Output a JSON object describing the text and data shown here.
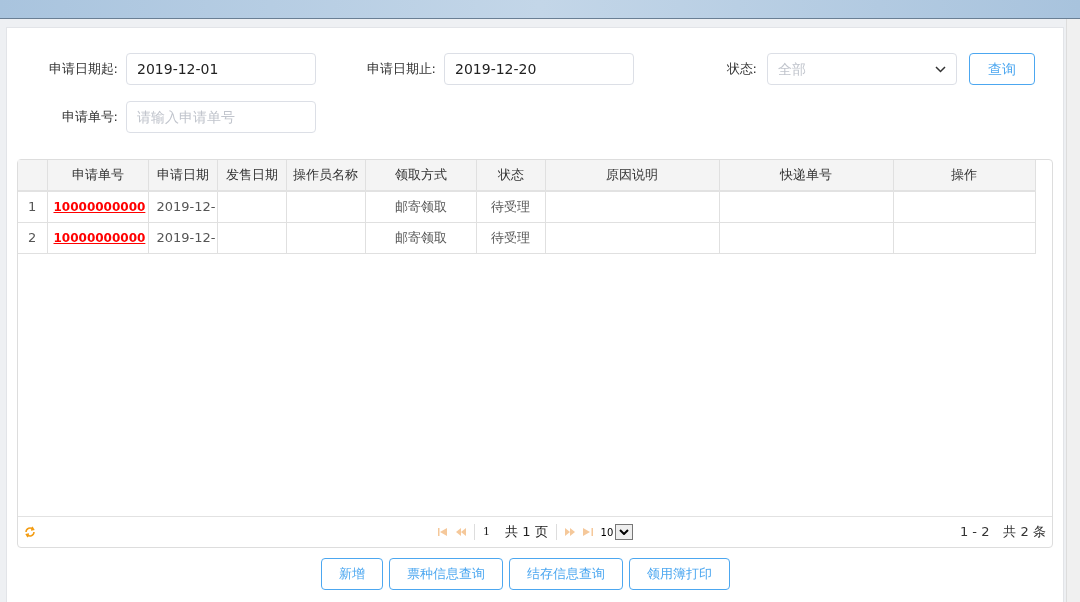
{
  "filters": [
    {
      "label": "申请日期起:",
      "value": "2019-12-01"
    },
    {
      "label": "申请日期止:",
      "value": "2019-12-20"
    },
    {
      "label": "申请单号:",
      "placeholder": "请输入申请单号"
    }
  ],
  "status_filter": {
    "label": "状态:",
    "placeholder": "全部"
  },
  "query_button": "查询",
  "table": {
    "columns": [
      "申请单号",
      "申请日期",
      "发售日期",
      "操作员名称",
      "领取方式",
      "状态",
      "原因说明",
      "快递单号",
      "操作"
    ],
    "rows": [
      {
        "index": "1",
        "cells": [
          "10000000000",
          "2019-12-",
          "",
          "",
          "邮寄领取",
          "待受理",
          "",
          "",
          ""
        ]
      },
      {
        "index": "2",
        "cells": [
          "10000000000",
          "2019-12-",
          "",
          "",
          "邮寄领取",
          "待受理",
          "",
          "",
          ""
        ]
      }
    ]
  },
  "pager": {
    "page": "1",
    "total_pages": "共 1 页",
    "page_size": "10",
    "summary": "1 - 2",
    "total": "共 2 条"
  },
  "buttons": [
    "新增",
    "票种信息查询",
    "结存信息查询",
    "领用簿打印"
  ]
}
